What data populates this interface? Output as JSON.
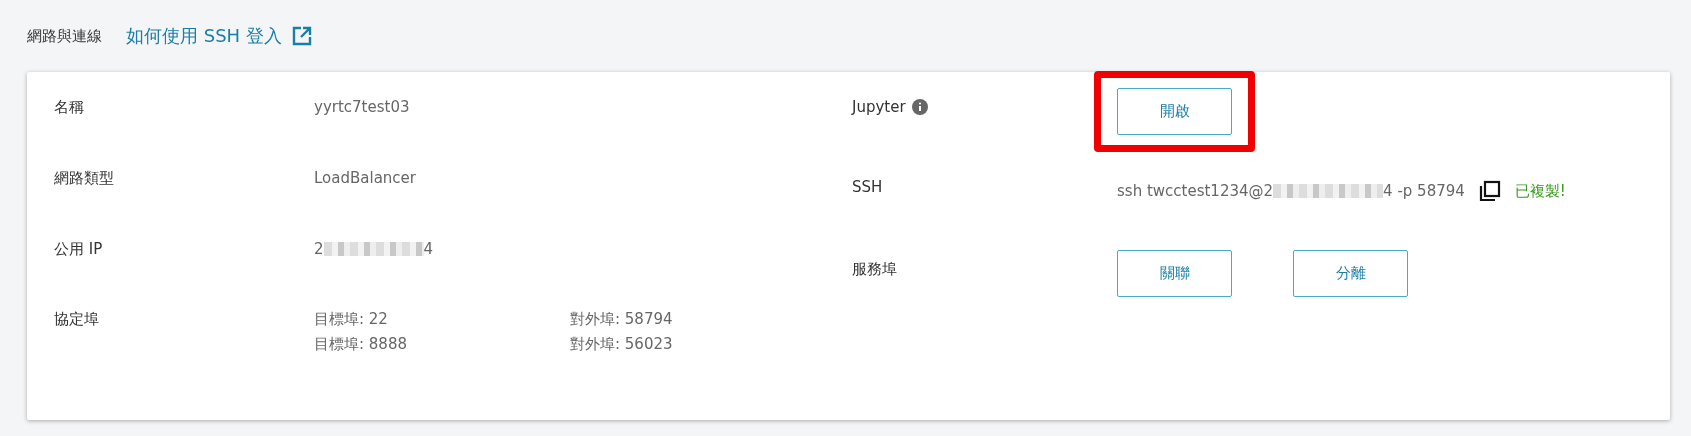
{
  "section": {
    "title": "網路與連線",
    "help_link": "如何使用 SSH 登入"
  },
  "left_fields": [
    {
      "label": "名稱",
      "kind": "text",
      "value": "yyrtc7test03"
    },
    {
      "label": "網路類型",
      "kind": "text",
      "value": "LoadBalancer"
    },
    {
      "label": "公用 IP",
      "kind": "redacted",
      "prefix": "2",
      "suffix": "4"
    },
    {
      "label": "協定埠",
      "kind": "ports",
      "ports": [
        {
          "target": "目標埠: 22",
          "external": "對外埠: 58794"
        },
        {
          "target": "目標埠: 8888",
          "external": "對外埠: 56023"
        }
      ]
    }
  ],
  "right_fields": [
    {
      "label": "Jupyter",
      "info": true,
      "kind": "buttons",
      "buttons": [
        {
          "label": "開啟",
          "highlighted": true
        }
      ]
    },
    {
      "label": "SSH",
      "info": false,
      "kind": "ssh",
      "prefix": "ssh twcctest1234@2",
      "suffix": "4 -p 58794",
      "copied": "已複製!"
    },
    {
      "label": "服務埠",
      "info": false,
      "kind": "buttons",
      "buttons": [
        {
          "label": "關聯",
          "highlighted": false
        },
        {
          "label": "分離",
          "highlighted": false
        }
      ]
    }
  ]
}
